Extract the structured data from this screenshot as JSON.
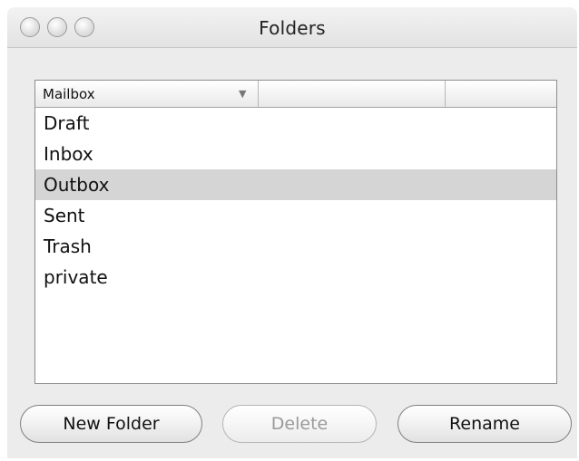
{
  "window": {
    "title": "Folders",
    "controls": [
      "close-button",
      "minimize-button",
      "zoom-button"
    ]
  },
  "table": {
    "columns": [
      "Mailbox",
      "",
      ""
    ],
    "sort_indicator": "▼",
    "rows": [
      "Draft",
      "Inbox",
      "Outbox",
      "Sent",
      "Trash",
      "private"
    ],
    "selected_row": "Outbox"
  },
  "buttons": {
    "new_folder": "New Folder",
    "delete": "Delete",
    "rename": "Rename"
  },
  "colors": {
    "window_bg": "#ececec",
    "selection": "#d5d5d5"
  }
}
